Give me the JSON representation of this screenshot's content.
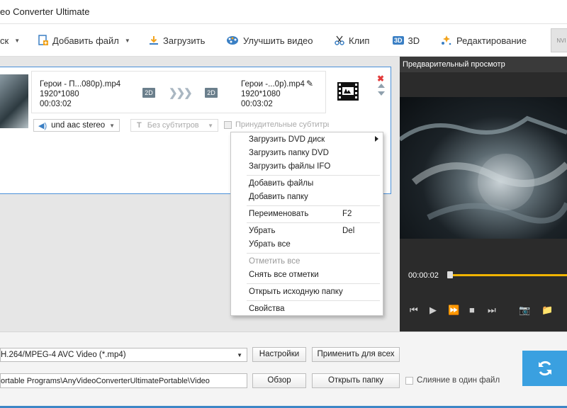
{
  "window": {
    "title": "eo Converter Ultimate"
  },
  "toolbar": {
    "disc_label": "ск",
    "add_file": "Добавить файл",
    "download": "Загрузить",
    "enhance": "Улучшить видео",
    "clip": "Клип",
    "three_d": "3D",
    "edit": "Редактирование",
    "nvidia": "NVI"
  },
  "item": {
    "source_name": "Герои - П...080p).mp4",
    "source_res": "1920*1080",
    "source_dur": "00:03:02",
    "badge_2d": "2D",
    "target_name": "Герои -...0p).mp4",
    "target_res": "1920*1080",
    "target_dur": "00:03:02",
    "audio": "und aac stereo",
    "subtitles": "Без субтитров",
    "force_subs": "Принудительные субтитры"
  },
  "preview": {
    "title": "Предварительный просмотр",
    "time": "00:00:02",
    "progress": 0.01,
    "accent": "#f0b400"
  },
  "menu": {
    "load_dvd": "Загрузить DVD диск",
    "load_dvd_folder": "Загрузить папку DVD",
    "load_ifo": "Загрузить файлы IFO",
    "add_files": "Добавить файлы",
    "add_folder": "Добавить папку",
    "rename": "Переименовать",
    "rename_key": "F2",
    "remove": "Убрать",
    "remove_key": "Del",
    "remove_all": "Убрать все",
    "check_all": "Отметить все",
    "uncheck_all": "Снять все отметки",
    "open_folder": "Открыть исходную папку",
    "properties": "Свойства"
  },
  "bottom": {
    "format": "H.264/MPEG-4 AVC Video (*.mp4)",
    "settings": "Настройки",
    "apply_all": "Применить для всех",
    "path": "ortable Programs\\AnyVideoConverterUltimatePortable\\Video",
    "browse": "Обзор",
    "open_folder": "Открыть папку",
    "merge": "Слияние в один файл"
  }
}
